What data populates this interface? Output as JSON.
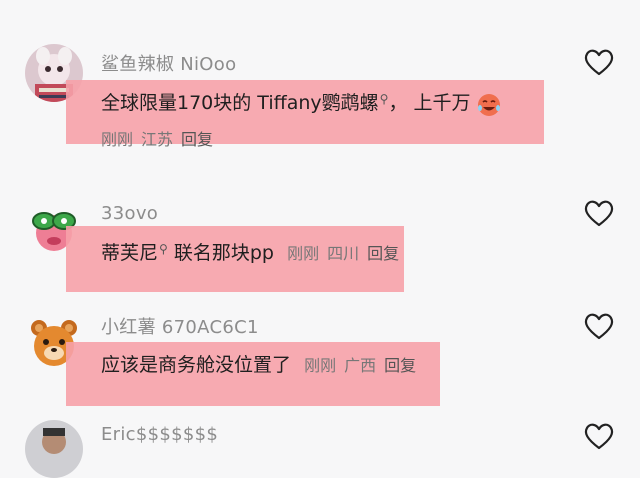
{
  "comments": [
    {
      "username": "鲨鱼辣椒 NiOoo",
      "text_before_link": "全球限量170块的 Tiffany鹦鹉螺",
      "text_after_link": "， 上千万",
      "time": "刚刚",
      "location": "江苏",
      "reply_label": "回复",
      "emoji": "crying-laughing-emoji"
    },
    {
      "username": "33ovo",
      "text_before_link": "蒂芙尼",
      "text_after_link": " 联名那块pp",
      "time": "刚刚",
      "location": "四川",
      "reply_label": "回复"
    },
    {
      "username": "小红薯 670AC6C1",
      "text": "应该是商务舱没位置了",
      "time": "刚刚",
      "location": "广西",
      "reply_label": "回复"
    },
    {
      "username": "Eric$$$$$$$"
    }
  ],
  "colors": {
    "highlight": "#f6a1a9",
    "background": "#f7f7f8"
  }
}
